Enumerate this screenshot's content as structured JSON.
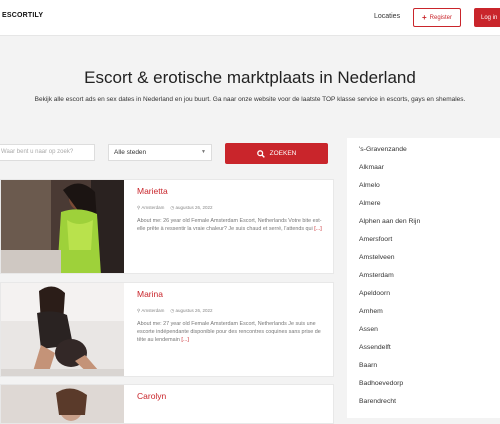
{
  "header": {
    "logo": "ESCORTILY",
    "nav_locaties": "Locaties",
    "register_label": "Register",
    "login_label": "Log in"
  },
  "hero": {
    "title": "Escort & erotische marktplaats in Nederland",
    "subtitle": "Bekijk alle escort ads en sex dates in Nederland en jou buurt. Ga naar onze website voor de laatste TOP klasse service in escorts, gays en shemales."
  },
  "search": {
    "placeholder": "Waar bent u naar op zoek?",
    "select_value": "Alle steden",
    "button_label": "ZOEKEN"
  },
  "listings": [
    {
      "name": "Marietta",
      "location": "Amsterdam",
      "date": "augustus 26, 2022",
      "description": "About me: 26 year old Female Amsterdam Escort, Netherlands Votre bite est-elle prête à ressentir la vraie chaleur? Je suis chaud et serré, l'attends qui",
      "more": "[...]"
    },
    {
      "name": "Marina",
      "location": "Amsterdam",
      "date": "augustus 26, 2022",
      "description": "About me: 27 year old Female Amsterdam Escort, Netherlands Je suis une escorte indépendante disponible pour des rencontres coquines sans prise de tête au lendemain",
      "more": "[...]"
    },
    {
      "name": "Carolyn",
      "location": "",
      "date": "",
      "description": "",
      "more": ""
    }
  ],
  "sidebar": {
    "cities": [
      "'s-Gravenzande",
      "Alkmaar",
      "Almelo",
      "Almere",
      "Alphen aan den Rijn",
      "Amersfoort",
      "Amstelveen",
      "Amsterdam",
      "Apeldoorn",
      "Arnhem",
      "Assen",
      "Assendelft",
      "Baarn",
      "Badhoevedorp",
      "Barendrecht"
    ]
  },
  "colors": {
    "accent": "#c9252b"
  },
  "icons": {
    "register": "plus-icon",
    "search": "search-icon",
    "location": "map-pin-icon",
    "date": "clock-icon"
  }
}
